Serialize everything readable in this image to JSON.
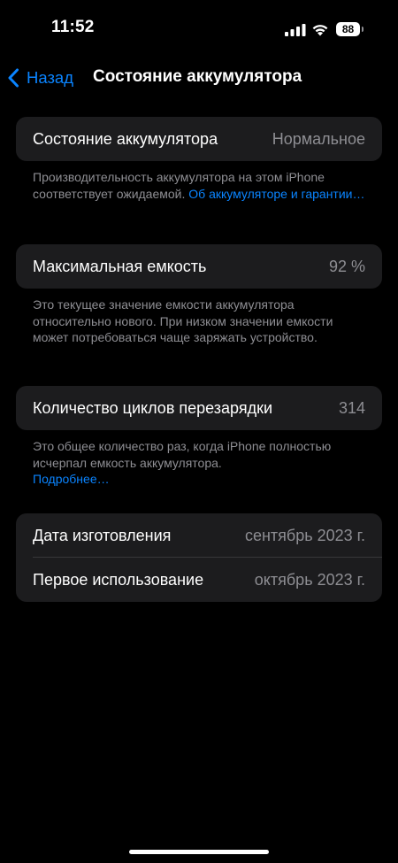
{
  "status_bar": {
    "time": "11:52",
    "battery_level": "88"
  },
  "nav": {
    "back_label": "Назад",
    "title": "Состояние аккумулятора"
  },
  "health": {
    "label": "Состояние аккумулятора",
    "value": "Нормальное",
    "footer_text": "Производительность аккумулятора на этом iPhone соответствует ожидаемой. ",
    "footer_link": "Об аккумуляторе и гарантии…"
  },
  "capacity": {
    "label": "Максимальная емкость",
    "value": "92 %",
    "footer_text": "Это текущее значение емкости аккумулятора относительно нового. При низком значении емкости может потребоваться чаще заряжать устройство."
  },
  "cycles": {
    "label": "Количество циклов перезарядки",
    "value": "314",
    "footer_text": "Это общее количество раз, когда iPhone полностью исчерпал емкость аккумулятора.",
    "footer_link": "Подробнее…"
  },
  "dates": {
    "manufacture_label": "Дата изготовления",
    "manufacture_value": "сентябрь 2023 г.",
    "first_use_label": "Первое использование",
    "first_use_value": "октябрь 2023 г."
  },
  "colors": {
    "accent": "#0a84ff",
    "background": "#000000",
    "cell": "#1c1c1e",
    "secondary_text": "#8e8e93"
  }
}
